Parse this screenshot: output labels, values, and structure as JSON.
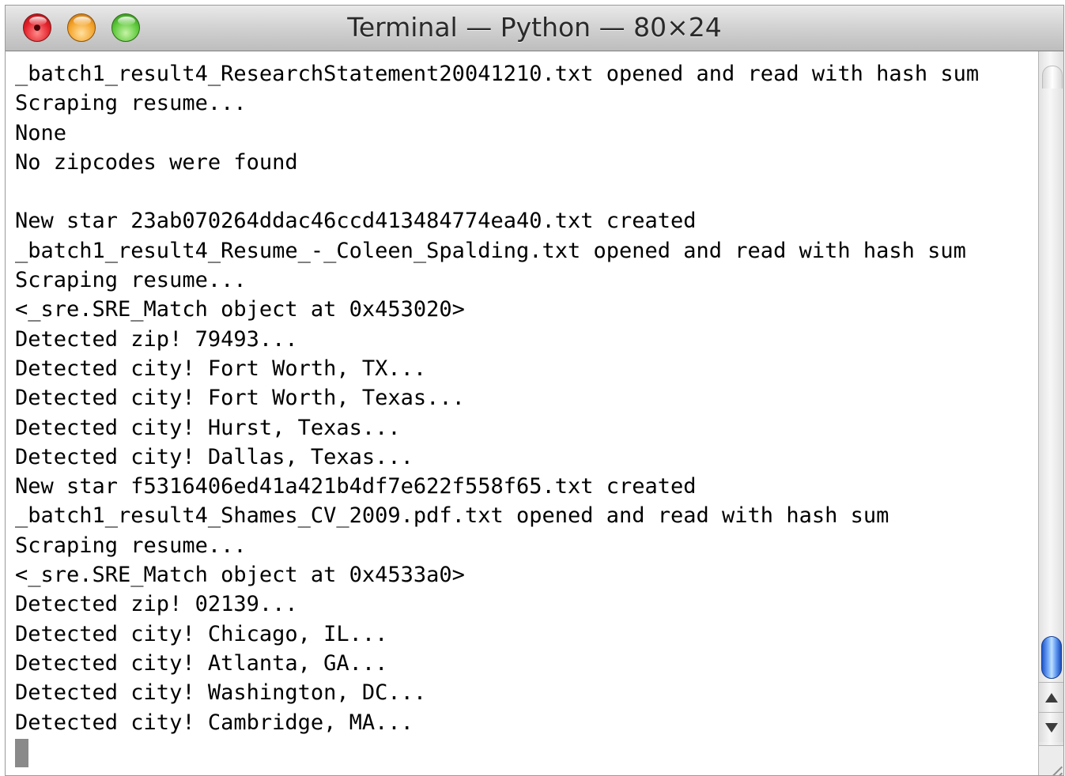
{
  "window": {
    "title": "Terminal — Python — 80×24"
  },
  "titlebar_buttons": {
    "close": "close-icon",
    "minimize": "minimize-icon",
    "zoom": "zoom-icon"
  },
  "terminal": {
    "lines": [
      "_batch1_result4_ResearchStatement20041210.txt opened and read with hash sum",
      "Scraping resume...",
      "None",
      "No zipcodes were found",
      "",
      "New star 23ab070264ddac46ccd413484774ea40.txt created",
      "_batch1_result4_Resume_-_Coleen_Spalding.txt opened and read with hash sum",
      "Scraping resume...",
      "<_sre.SRE_Match object at 0x453020>",
      "Detected zip! 79493...",
      "Detected city! Fort Worth, TX...",
      "Detected city! Fort Worth, Texas...",
      "Detected city! Hurst, Texas...",
      "Detected city! Dallas, Texas...",
      "New star f5316406ed41a421b4df7e622f558f65.txt created",
      "_batch1_result4_Shames_CV_2009.pdf.txt opened and read with hash sum",
      "Scraping resume...",
      "<_sre.SRE_Match object at 0x4533a0>",
      "Detected zip! 02139...",
      "Detected city! Chicago, IL...",
      "Detected city! Atlanta, GA...",
      "Detected city! Washington, DC...",
      "Detected city! Cambridge, MA..."
    ]
  },
  "scrollbar": {
    "position_fraction": 0.93,
    "up_arrow": "arrow-up-icon",
    "down_arrow": "arrow-down-icon"
  },
  "colors": {
    "thumb": "#3a78e0",
    "close": "#e3212a",
    "minimize": "#f4a32a",
    "zoom": "#5cc83a"
  }
}
